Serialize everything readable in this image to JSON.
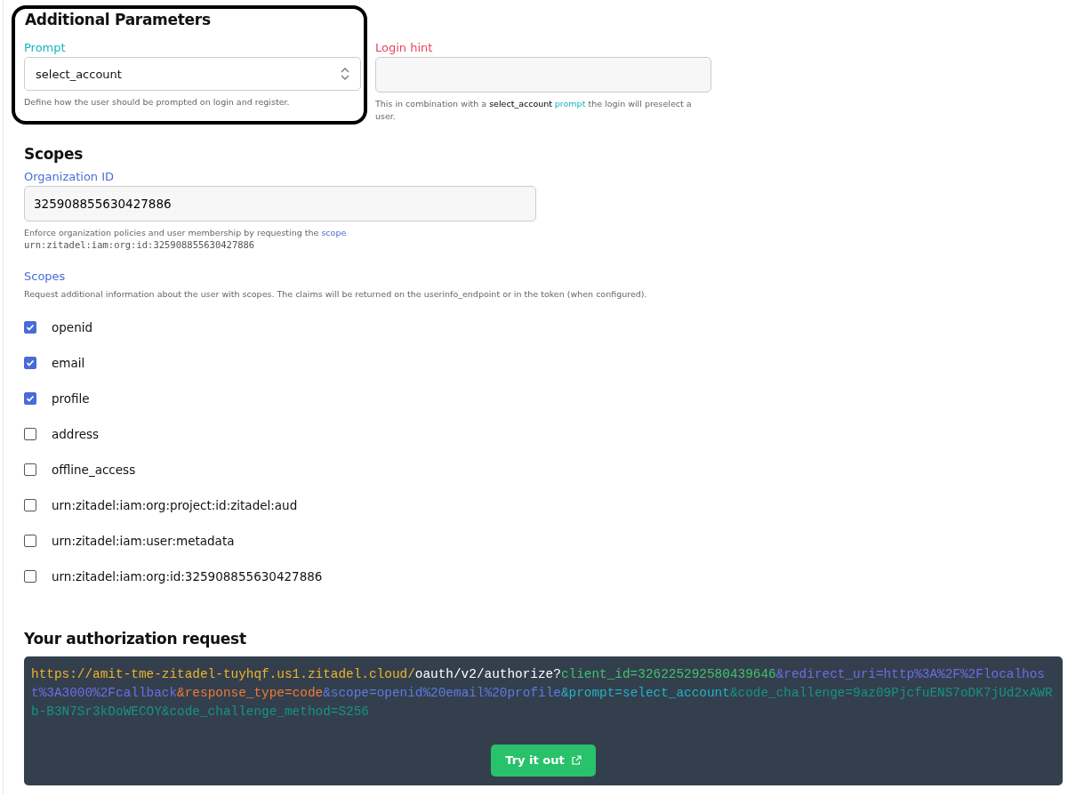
{
  "additional": {
    "title": "Additional Parameters",
    "prompt": {
      "label": "Prompt",
      "value": "select_account",
      "help": "Define how the user should be prompted on login and register."
    },
    "login_hint": {
      "label": "Login hint",
      "help_parts": [
        {
          "text": "This in combination with a ",
          "kind": "plain"
        },
        {
          "text": "select_account",
          "kind": "strong"
        },
        {
          "text": "prompt",
          "kind": "link"
        },
        {
          "text": " the login will preselect a user.",
          "kind": "plain"
        }
      ]
    }
  },
  "scopes": {
    "title": "Scopes",
    "org": {
      "label": "Organization ID",
      "value": "325908855630427886",
      "help": "Enforce organization policies and user membership by requesting the",
      "help_link": "scope",
      "code": "urn:zitadel:iam:org:id:325908855630427886"
    },
    "label": "Scopes",
    "help": "Request additional information about the user with scopes. The claims will be returned on the userinfo_endpoint or in the token (when configured).",
    "items": [
      {
        "name": "openid",
        "checked": true
      },
      {
        "name": "email",
        "checked": true
      },
      {
        "name": "profile",
        "checked": true
      },
      {
        "name": "address",
        "checked": false
      },
      {
        "name": "offline_access",
        "checked": false
      },
      {
        "name": "urn:zitadel:iam:org:project:id:zitadel:aud",
        "checked": false
      },
      {
        "name": "urn:zitadel:iam:user:metadata",
        "checked": false
      },
      {
        "name": "urn:zitadel:iam:org:id:325908855630427886",
        "checked": false
      }
    ]
  },
  "request": {
    "title": "Your authorization request",
    "segments": [
      {
        "text": "https://amit-tme-zitadel-tuyhqf.us1.zitadel.cloud/",
        "color": "#f0b429"
      },
      {
        "text": "oauth/v2/authorize?",
        "color": "#ffffff"
      },
      {
        "text": "client_id=326225292580439646",
        "color": "#3ec46d"
      },
      {
        "text": "&redirect_uri=http%3A%2F%2Flocalhost%3A3000%2Fcallback",
        "color": "#6b6ee6"
      },
      {
        "text": "&response_type=code",
        "color": "#f07a36"
      },
      {
        "text": "&scope=openid%20email%20profile",
        "color": "#5b7be2"
      },
      {
        "text": "&prompt=select_account",
        "color": "#1fb3c4"
      },
      {
        "text": "&code_challenge=9az09PjcfuENS7oDK7jUd2xAWRb-B3N7Sr3kDoWECOY&code_challenge_method=S256",
        "color": "#139484"
      }
    ],
    "button": "Try it out"
  }
}
